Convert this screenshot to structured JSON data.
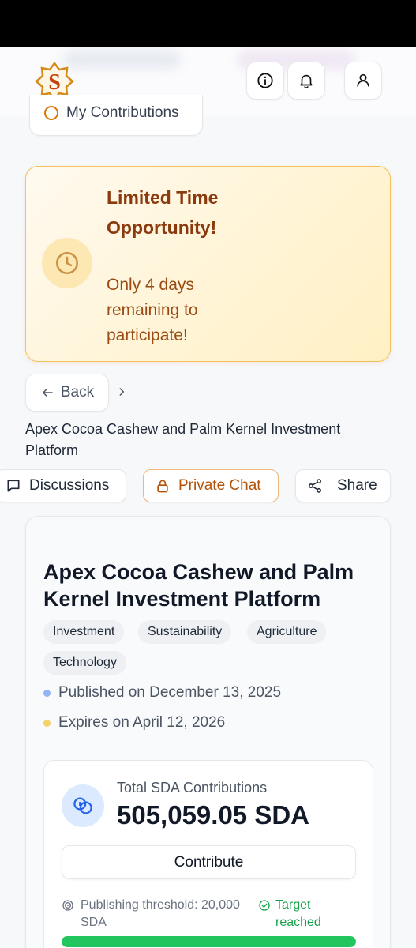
{
  "header": {
    "logo_icon": "sda-star-logo",
    "info_icon": "info-icon",
    "bell_icon": "bell-icon",
    "user_icon": "user-icon"
  },
  "nav": {
    "my_contributions_label": "My Contributions"
  },
  "promo": {
    "title": "Limited Time Opportunity!",
    "subtitle": "Only 4 days remaining to participate!",
    "icon": "clock-icon"
  },
  "breadcrumb": {
    "back_label": "Back",
    "current": "Apex Cocoa Cashew and Palm Kernel Investment Platform"
  },
  "actions": {
    "discussions_label": "Discussions",
    "private_chat_label": "Private Chat",
    "share_label": "Share"
  },
  "project": {
    "title": "Apex Cocoa Cashew and Palm Kernel Investment Platform",
    "tags": [
      "Investment",
      "Sustainability",
      "Agriculture",
      "Technology"
    ],
    "published": "Published on December 13, 2025",
    "expires": "Expires on April 12, 2026"
  },
  "contributions": {
    "label": "Total SDA Contributions",
    "value": "505,059.05 SDA",
    "contribute_label": "Contribute",
    "threshold": "Publishing threshold: 20,000 SDA",
    "target_status": "Target reached",
    "progress_fraction": 1.0
  },
  "colors": {
    "accent_amber": "#b45309",
    "promo_title": "#8a3a0d",
    "success": "#16a34a",
    "progress": "#22c55e",
    "dot_published": "#93b4f5",
    "dot_expires": "#f5d36b"
  }
}
